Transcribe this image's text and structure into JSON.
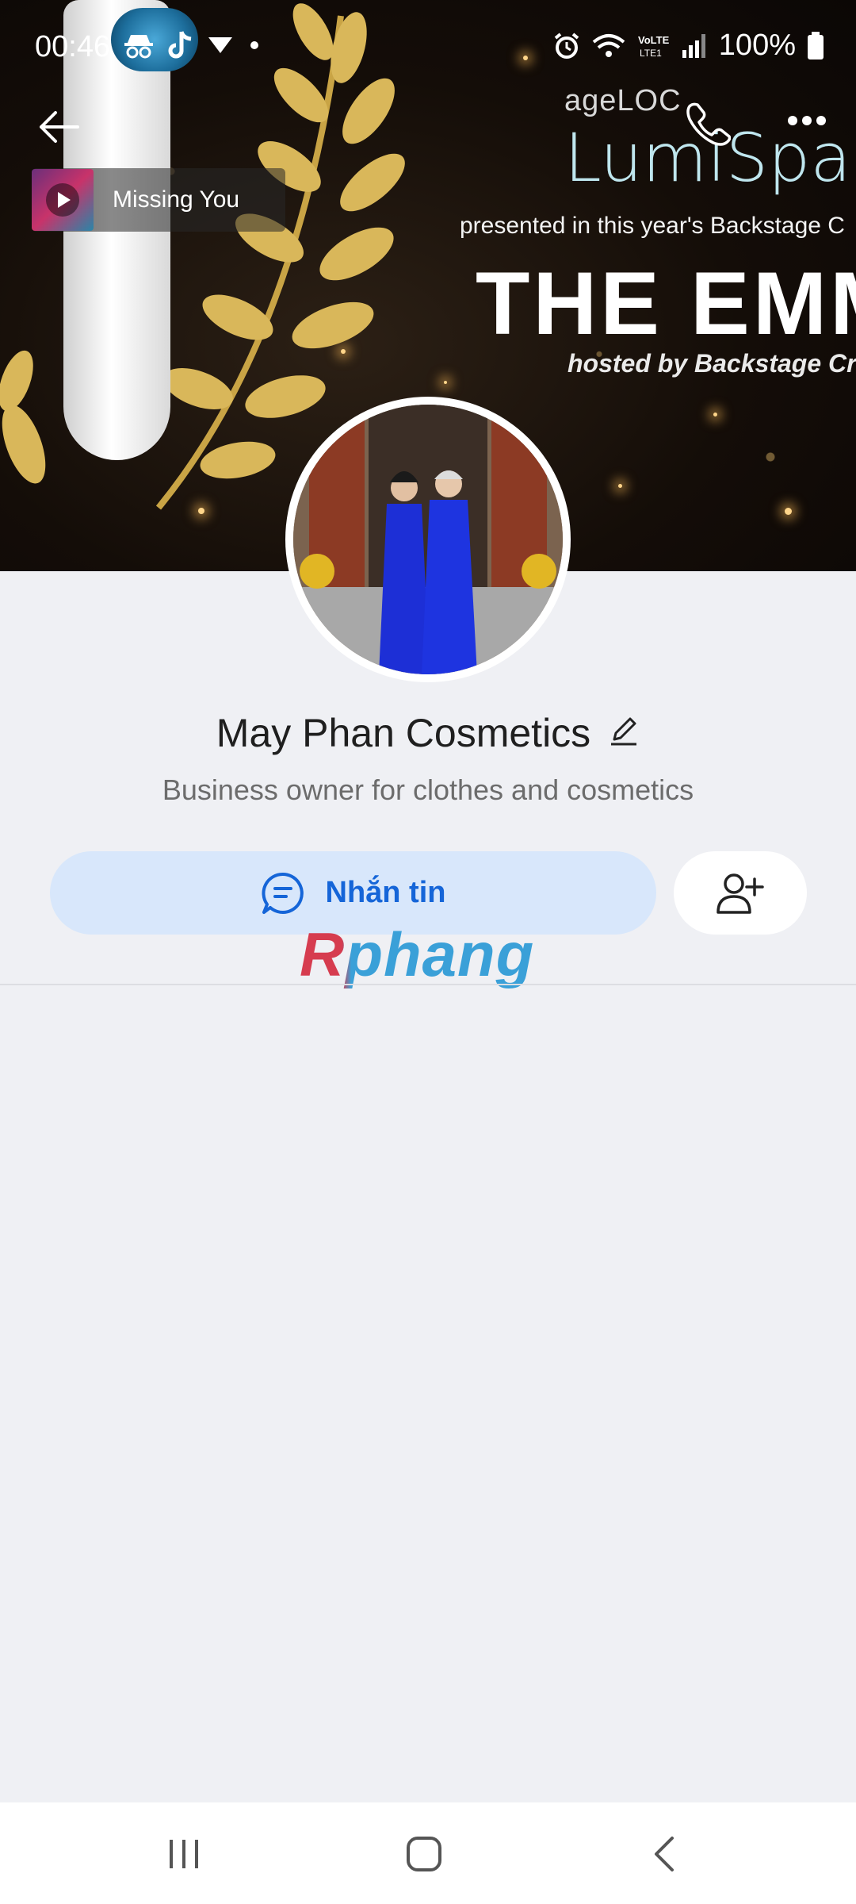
{
  "status_bar": {
    "time": "00:46",
    "battery": "100%",
    "network": "LTE1"
  },
  "cover": {
    "brand_sub": "ageLOC",
    "brand_main": "LumiSpa",
    "presented": "presented in this year's Backstage C",
    "emmy": "THE EMM",
    "hosted": "hosted by Backstage Crea"
  },
  "music": {
    "title": "Missing You"
  },
  "profile": {
    "name": "May Phan Cosmetics",
    "bio": "Business owner for clothes and cosmetics"
  },
  "actions": {
    "message_label": "Nhắn tin"
  },
  "watermark": "Rphang",
  "icons": {
    "back": "back-arrow-icon",
    "call": "phone-icon",
    "more": "more-dots-icon",
    "edit": "pencil-icon",
    "chat": "chat-bubble-icon",
    "add_friend": "add-user-icon",
    "recents": "recent-apps-icon",
    "home": "home-icon",
    "nav_back": "nav-back-icon"
  },
  "colors": {
    "accent": "#1565d8",
    "button_bg": "#d8e7fb",
    "page_bg": "#eff0f4"
  }
}
